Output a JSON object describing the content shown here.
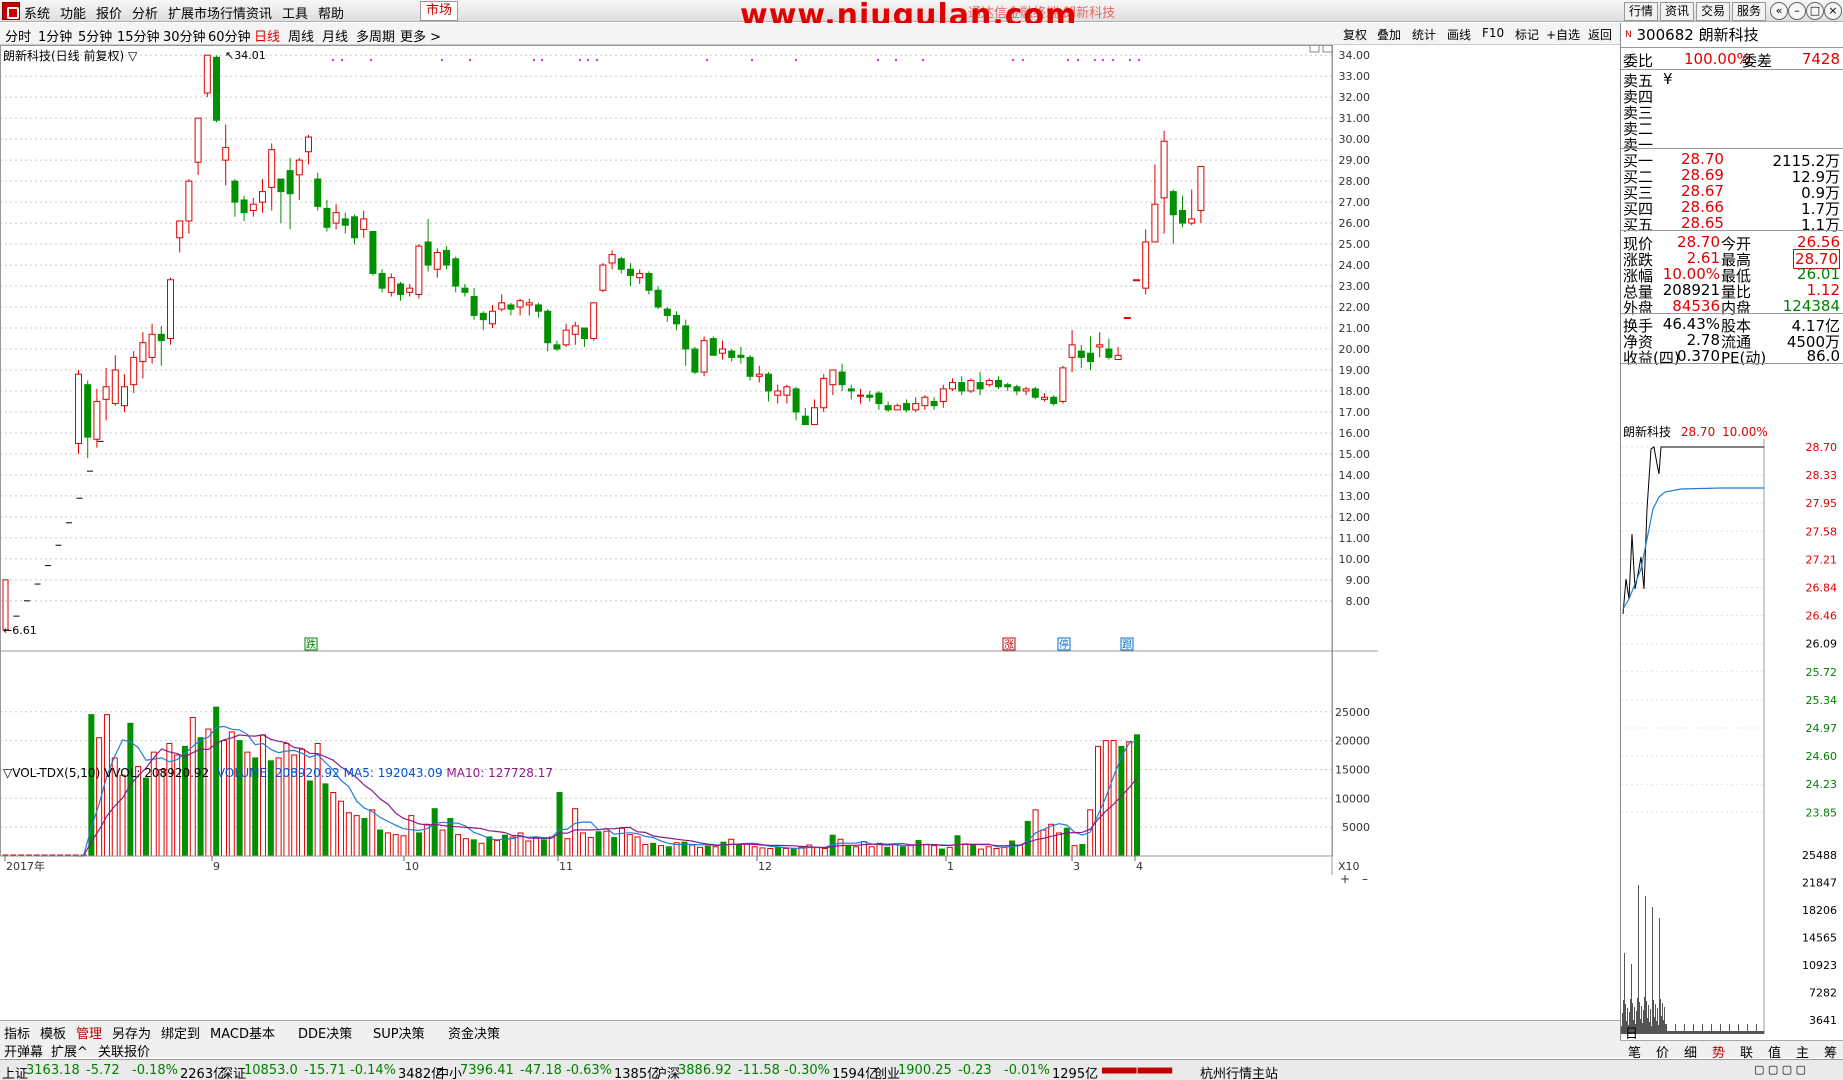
{
  "menu": [
    "系统",
    "功能",
    "报价",
    "分析",
    "扩展市场行情",
    "资讯",
    "工具",
    "帮助"
  ],
  "menu_market": "市场",
  "watermark": "www.niugulan.com",
  "watermark_sub": "通达信金融终端  朗新科技",
  "top_buttons": [
    "行情",
    "资讯",
    "交易",
    "服务"
  ],
  "window_controls": [
    "«",
    "–",
    "□",
    "×"
  ],
  "periods": [
    "分时",
    "1分钟",
    "5分钟",
    "15分钟",
    "30分钟",
    "60分钟",
    "日线",
    "周线",
    "月线",
    "多周期",
    "更多 >"
  ],
  "active_period": "日线",
  "tools": [
    "复权",
    "叠加",
    "统计",
    "画线",
    "F10",
    "标记",
    "+自选",
    "返回"
  ],
  "stock_title": "朗新科技(日线 前复权) ▽",
  "max_label": "34.01",
  "min_label": "6.61",
  "price_axis": [
    "34.00",
    "33.00",
    "32.00",
    "31.00",
    "30.00",
    "29.00",
    "28.00",
    "27.00",
    "26.00",
    "25.00",
    "24.00",
    "23.00",
    "22.00",
    "21.00",
    "20.00",
    "19.00",
    "18.00",
    "17.00",
    "16.00",
    "15.00",
    "14.00",
    "13.00",
    "12.00",
    "11.00",
    "10.00",
    "9.00",
    "8.00"
  ],
  "vol_axis": [
    "25000",
    "20000",
    "15000",
    "10000",
    "5000"
  ],
  "vol_unit": "X10",
  "vol_legend": {
    "name": "▽VOL-TDX(5,10)",
    "vvol": "VVOL: 208920.92",
    "volume": "VOLUME: 208920.92",
    "ma5": "MA5: 192043.09",
    "ma10": "MA10: 127728.17"
  },
  "date_labels": [
    "2017年",
    "9",
    "10",
    "11",
    "12",
    "1",
    "3",
    "4"
  ],
  "markers": [
    "跌",
    "涨",
    "停",
    "跟"
  ],
  "corner_label": "日线",
  "colors": {
    "up": "#e00000",
    "down": "#009000",
    "ma5": "#1e7fd4",
    "ma10": "#8b1a8b",
    "grid": "#c8c8c8"
  },
  "quote": {
    "code": "300682",
    "name": "朗新科技",
    "weibi_label": "委比",
    "weibi": "100.00%",
    "weicha_label": "委差",
    "weicha": "7428",
    "sell": [
      [
        "卖五",
        "¥"
      ],
      [
        "卖四",
        ""
      ],
      [
        "卖三",
        ""
      ],
      [
        "卖二",
        ""
      ],
      [
        "卖一",
        ""
      ]
    ],
    "buy": [
      [
        "买一",
        "28.70",
        "2115.2万"
      ],
      [
        "买二",
        "28.69",
        "12.9万"
      ],
      [
        "买三",
        "28.67",
        "0.9万"
      ],
      [
        "买四",
        "28.66",
        "1.7万"
      ],
      [
        "买五",
        "28.65",
        "1.1万"
      ]
    ],
    "stats": [
      [
        "现价",
        "28.70",
        "今开",
        "26.56"
      ],
      [
        "涨跌",
        "2.61",
        "最高",
        "28.70"
      ],
      [
        "涨幅",
        "10.00%",
        "最低",
        "26.01"
      ],
      [
        "总量",
        "208921",
        "量比",
        "1.12"
      ],
      [
        "外盘",
        "84536",
        "内盘",
        "124384"
      ]
    ],
    "stats2": [
      [
        "换手",
        "46.43%",
        "股本",
        "4.17亿"
      ],
      [
        "净资",
        "2.78",
        "流通",
        "4500万"
      ],
      [
        "收益(四)",
        "0.370",
        "PE(动)",
        "86.0"
      ]
    ]
  },
  "tick": {
    "name": "朗新科技",
    "price": "28.70",
    "pct": "10.00%",
    "price_axis": [
      "28.70",
      "28.33",
      "27.95",
      "27.58",
      "27.21",
      "26.84",
      "26.46",
      "26.09",
      "25.72",
      "25.34",
      "24.97",
      "24.60",
      "24.23",
      "23.85"
    ],
    "vol_axis": [
      "25488",
      "21847",
      "18206",
      "14565",
      "10923",
      "7282",
      "3641"
    ]
  },
  "bottom_tabs": [
    "指标",
    "模板",
    "管理",
    "另存为",
    "绑定到",
    "MACD基本",
    "DDE决策",
    "SUP决策",
    "资金决策"
  ],
  "bottom_tabs2": [
    "开弹幕",
    "扩展^",
    "关联报价"
  ],
  "right_tabs": [
    "笔",
    "价",
    "细",
    "势",
    "联",
    "值",
    "主",
    "筹"
  ],
  "status": [
    {
      "name": "上证",
      "val": "3163.18",
      "chg": "-5.72",
      "pct": "-0.18%",
      "amt": "2263亿"
    },
    {
      "name": "深证",
      "val": "10853.0",
      "chg": "-15.71",
      "pct": "-0.14%",
      "amt": "3482亿"
    },
    {
      "name": "中小",
      "val": "7396.41",
      "chg": "-47.18",
      "pct": "-0.63%",
      "amt": "1385亿"
    },
    {
      "name": "沪深",
      "val": "3886.92",
      "chg": "-11.58",
      "pct": "-0.30%",
      "amt": "1594亿"
    },
    {
      "name": "创业",
      "val": "1900.25",
      "chg": "-0.23",
      "pct": "-0.01%",
      "amt": "1295亿"
    }
  ],
  "status_station": "杭州行情主站",
  "chart_data": {
    "type": "candlestick",
    "title": "朗新科技(日线 前复权)",
    "ylim": [
      6.61,
      34.01
    ],
    "ipo_ladder": [
      6.61,
      7.27,
      8.0,
      8.8,
      9.68,
      10.65,
      11.72,
      12.89,
      14.18,
      15.6
    ],
    "candles": [
      [
        15.5,
        18.8,
        15.0,
        19.0
      ],
      [
        18.3,
        15.8,
        14.8,
        18.5
      ],
      [
        15.7,
        17.5,
        15.3,
        18.1
      ],
      [
        17.6,
        18.2,
        16.6,
        19.1
      ],
      [
        17.4,
        19.0,
        17.3,
        19.7
      ],
      [
        17.3,
        18.2,
        17.0,
        18.8
      ],
      [
        18.3,
        19.6,
        17.9,
        19.9
      ],
      [
        19.4,
        20.3,
        18.6,
        20.8
      ],
      [
        19.6,
        20.7,
        19.3,
        21.2
      ],
      [
        20.7,
        20.4,
        19.2,
        21.1
      ],
      [
        20.5,
        23.3,
        20.2,
        23.4
      ],
      [
        25.3,
        26.1,
        24.6,
        26.1
      ],
      [
        26.1,
        28.0,
        25.5,
        28.1
      ],
      [
        28.9,
        31.0,
        28.3,
        31.0
      ],
      [
        32.2,
        34.0,
        32.0,
        34.0
      ],
      [
        33.9,
        30.9,
        30.8,
        34.0
      ],
      [
        29.0,
        29.6,
        27.8,
        30.7
      ],
      [
        28.0,
        27.0,
        26.3,
        28.1
      ],
      [
        27.1,
        26.5,
        26.1,
        27.3
      ],
      [
        26.6,
        26.9,
        26.3,
        27.2
      ],
      [
        27.0,
        27.5,
        26.5,
        28.1
      ],
      [
        27.7,
        29.5,
        26.6,
        29.8
      ],
      [
        28.1,
        27.5,
        26.0,
        28.1
      ],
      [
        28.5,
        27.4,
        25.7,
        29.1
      ],
      [
        28.3,
        29.0,
        27.1,
        29.1
      ],
      [
        29.4,
        30.1,
        28.8,
        30.2
      ],
      [
        28.1,
        26.8,
        26.6,
        28.4
      ],
      [
        26.7,
        25.8,
        25.6,
        27.1
      ],
      [
        26.0,
        26.5,
        25.7,
        26.9
      ],
      [
        26.2,
        25.9,
        25.5,
        26.5
      ],
      [
        26.3,
        25.3,
        25.0,
        26.4
      ],
      [
        25.7,
        26.2,
        25.3,
        26.6
      ],
      [
        25.6,
        23.6,
        23.5,
        25.6
      ],
      [
        23.6,
        22.9,
        22.7,
        23.8
      ],
      [
        22.7,
        23.4,
        22.5,
        23.6
      ],
      [
        23.1,
        22.6,
        22.3,
        23.2
      ],
      [
        22.7,
        22.9,
        22.5,
        23.1
      ],
      [
        22.6,
        24.9,
        22.4,
        25.0
      ],
      [
        25.1,
        24.0,
        23.7,
        26.2
      ],
      [
        23.8,
        24.6,
        23.4,
        24.8
      ],
      [
        24.7,
        24.0,
        23.8,
        24.9
      ],
      [
        24.3,
        23.0,
        22.7,
        24.4
      ],
      [
        22.9,
        22.7,
        22.5,
        23.1
      ],
      [
        22.5,
        21.6,
        21.4,
        22.9
      ],
      [
        21.7,
        21.4,
        20.9,
        21.8
      ],
      [
        21.2,
        21.8,
        21.0,
        22.1
      ],
      [
        21.9,
        22.2,
        21.8,
        22.6
      ],
      [
        22.1,
        21.9,
        21.6,
        22.2
      ],
      [
        22.0,
        22.3,
        21.6,
        22.4
      ],
      [
        22.1,
        22.2,
        21.6,
        22.4
      ],
      [
        22.1,
        21.8,
        21.5,
        22.2
      ],
      [
        21.8,
        20.3,
        19.9,
        21.9
      ],
      [
        20.2,
        20.0,
        19.9,
        20.4
      ],
      [
        20.2,
        20.9,
        20.1,
        21.2
      ],
      [
        20.7,
        21.1,
        20.2,
        21.3
      ],
      [
        21.0,
        20.5,
        20.1,
        21.0
      ],
      [
        20.5,
        22.2,
        20.4,
        22.2
      ],
      [
        22.8,
        24.0,
        22.7,
        24.1
      ],
      [
        24.1,
        24.5,
        23.8,
        24.7
      ],
      [
        24.3,
        23.8,
        23.6,
        24.4
      ],
      [
        23.8,
        23.5,
        23.0,
        24.1
      ],
      [
        23.4,
        23.6,
        23.1,
        23.8
      ],
      [
        23.6,
        22.8,
        22.6,
        23.7
      ],
      [
        22.8,
        22.0,
        21.9,
        23.0
      ],
      [
        21.9,
        21.6,
        21.3,
        22.0
      ],
      [
        21.6,
        21.2,
        20.9,
        21.8
      ],
      [
        21.1,
        20.0,
        19.2,
        21.4
      ],
      [
        20.0,
        18.9,
        18.8,
        20.1
      ],
      [
        18.9,
        20.4,
        18.7,
        20.6
      ],
      [
        20.5,
        19.7,
        19.7,
        20.6
      ],
      [
        19.8,
        20.0,
        19.5,
        20.4
      ],
      [
        19.9,
        19.6,
        19.4,
        20.0
      ],
      [
        19.7,
        19.6,
        19.3,
        20.1
      ],
      [
        19.6,
        18.7,
        18.5,
        19.7
      ],
      [
        18.7,
        18.8,
        18.4,
        19.2
      ],
      [
        18.8,
        18.0,
        17.5,
        18.9
      ],
      [
        17.8,
        18.0,
        17.4,
        18.3
      ],
      [
        17.8,
        18.2,
        17.4,
        18.3
      ],
      [
        18.1,
        17.0,
        16.6,
        18.2
      ],
      [
        16.8,
        16.4,
        16.4,
        17.2
      ],
      [
        16.4,
        17.2,
        16.4,
        17.6
      ],
      [
        17.2,
        18.6,
        17.0,
        18.8
      ],
      [
        18.3,
        19.0,
        17.8,
        19.0
      ],
      [
        18.9,
        18.3,
        18.0,
        19.3
      ],
      [
        18.1,
        18.0,
        17.6,
        18.3
      ],
      [
        17.8,
        17.8,
        17.4,
        18.1
      ],
      [
        17.8,
        17.7,
        17.5,
        18.0
      ],
      [
        17.9,
        17.4,
        17.1,
        18.0
      ],
      [
        17.3,
        17.1,
        17.0,
        17.5
      ],
      [
        17.1,
        17.3,
        17.1,
        17.4
      ],
      [
        17.4,
        17.1,
        17.0,
        17.6
      ],
      [
        17.1,
        17.4,
        17.0,
        17.7
      ],
      [
        17.3,
        17.7,
        17.1,
        17.8
      ],
      [
        17.5,
        17.3,
        17.1,
        17.7
      ],
      [
        17.5,
        18.1,
        17.2,
        18.3
      ],
      [
        18.1,
        18.4,
        18.0,
        18.6
      ],
      [
        18.4,
        18.0,
        17.8,
        18.7
      ],
      [
        18.0,
        18.5,
        17.9,
        18.6
      ],
      [
        18.4,
        18.1,
        17.8,
        18.9
      ],
      [
        18.3,
        18.5,
        18.2,
        18.6
      ],
      [
        18.5,
        18.2,
        18.1,
        18.7
      ],
      [
        18.3,
        18.2,
        18.0,
        18.4
      ],
      [
        18.2,
        18.0,
        17.8,
        18.3
      ],
      [
        18.0,
        18.1,
        17.8,
        18.2
      ],
      [
        18.1,
        17.7,
        17.6,
        18.2
      ],
      [
        17.6,
        17.7,
        17.5,
        17.9
      ],
      [
        17.7,
        17.4,
        17.3,
        17.8
      ],
      [
        17.5,
        19.1,
        17.4,
        19.2
      ],
      [
        19.6,
        20.2,
        18.9,
        20.9
      ],
      [
        19.9,
        19.6,
        19.1,
        20.2
      ],
      [
        19.8,
        19.4,
        19.0,
        20.6
      ],
      [
        20.1,
        20.2,
        19.6,
        20.8
      ],
      [
        20.0,
        19.6,
        19.5,
        20.5
      ],
      [
        19.5,
        19.7,
        19.5,
        20.1
      ],
      [
        21.5,
        21.5,
        21.5,
        21.5
      ],
      [
        23.3,
        23.3,
        23.3,
        23.3
      ],
      [
        22.9,
        25.1,
        22.6,
        25.7
      ],
      [
        25.1,
        26.9,
        25.3,
        28.8
      ],
      [
        27.2,
        29.9,
        25.5,
        30.4
      ],
      [
        27.5,
        26.4,
        25.0,
        27.6
      ],
      [
        26.6,
        26.0,
        25.8,
        27.3
      ],
      [
        26.0,
        26.2,
        25.9,
        27.6
      ],
      [
        26.6,
        28.7,
        26.0,
        28.7
      ]
    ],
    "volumes_x10": [
      1,
      1,
      1,
      1,
      1,
      1,
      1,
      1,
      1,
      1,
      2,
      24500,
      20500,
      24500,
      17000,
      14000,
      23000,
      15500,
      13500,
      18000,
      15000,
      19500,
      17500,
      19000,
      24000,
      20500,
      22000,
      25800,
      20000,
      21500,
      20000,
      18000,
      17000,
      21000,
      16500,
      17000,
      19500,
      17500,
      18500,
      13000,
      19500,
      12500,
      11000,
      9500,
      7500,
      7000,
      6500,
      8000,
      4500,
      4000,
      3700,
      3500,
      7000,
      4000,
      5500,
      8200,
      4500,
      6500,
      3700,
      3000,
      2800,
      2200,
      3300,
      2700,
      3600,
      3300,
      4000,
      2600,
      3200,
      2800,
      3300,
      11000,
      3000,
      8200,
      4000,
      3200,
      4200,
      4300,
      3200,
      4800,
      3700,
      3300,
      2000,
      2200,
      1800,
      1600,
      2300,
      2400,
      1900,
      1500,
      1700,
      1600,
      2400,
      2900,
      1900,
      2100,
      1600,
      1400,
      1300,
      1500,
      1300,
      1200,
      1500,
      1900,
      1500,
      1300,
      3600,
      2900,
      1800,
      1600,
      2500,
      1600,
      2200,
      1500,
      2000,
      1600,
      1800,
      2700,
      2000,
      1800,
      1200,
      1500,
      3500,
      2100,
      1900,
      1200,
      1600,
      1300,
      1500,
      2600,
      1900,
      6000,
      8000,
      4500,
      5500,
      4000,
      4800,
      1800,
      2000,
      8000,
      19000,
      20000,
      20000,
      19000,
      19800,
      21000
    ],
    "ma_labels": [
      "MA5",
      "MA10"
    ]
  }
}
